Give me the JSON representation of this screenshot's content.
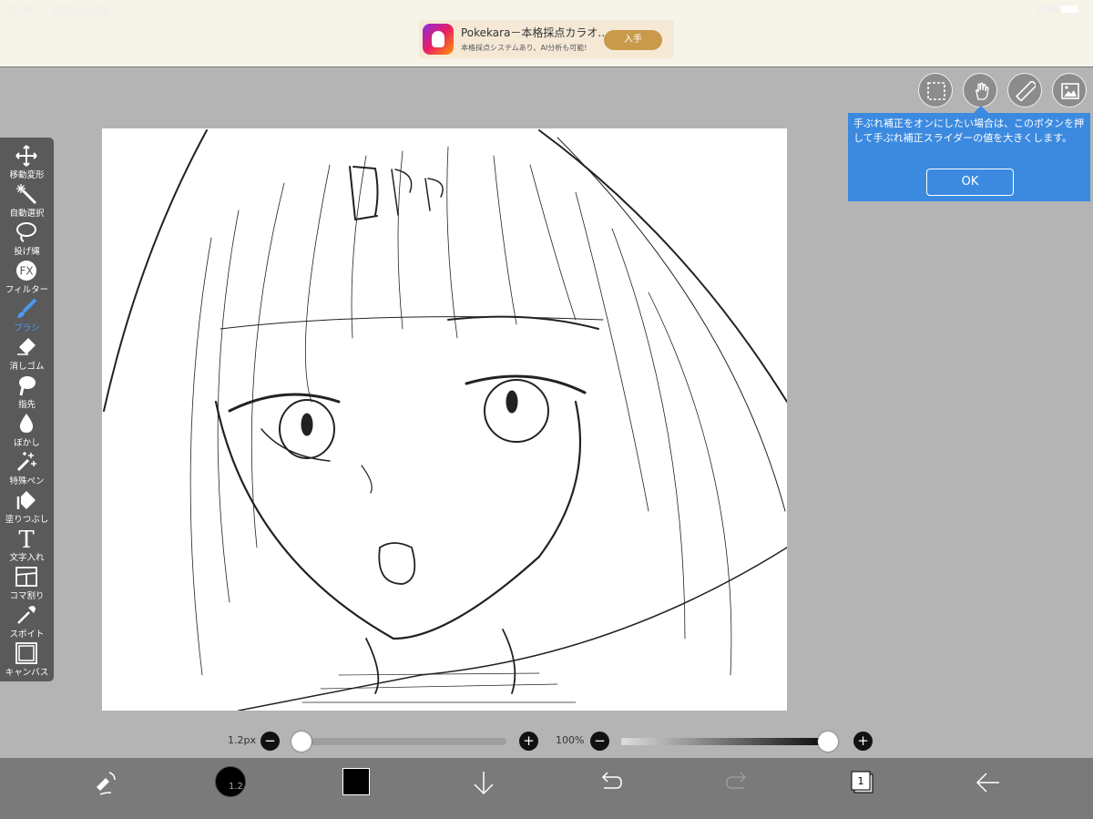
{
  "status": {
    "time": "22:49",
    "date": "2月27日(日)",
    "battery": "92%"
  },
  "ad": {
    "title": "Pokekara－本格採点カラオ...",
    "subtitle": "本格採点システムあり、AI分析も可能!",
    "button": "入手"
  },
  "tooltip": {
    "message": "手ぶれ補正をオンにしたい場合は、このボタンを押して手ぶれ補正スライダーの値を大きくします。",
    "ok": "OK"
  },
  "tools": [
    {
      "label": "移動変形",
      "icon": "move-icon"
    },
    {
      "label": "自動選択",
      "icon": "magic-wand-icon"
    },
    {
      "label": "投げ縄",
      "icon": "lasso-icon"
    },
    {
      "label": "フィルター",
      "icon": "fx-icon"
    },
    {
      "label": "ブラシ",
      "icon": "brush-icon",
      "active": true
    },
    {
      "label": "消しゴム",
      "icon": "eraser-icon"
    },
    {
      "label": "指先",
      "icon": "finger-icon"
    },
    {
      "label": "ぼかし",
      "icon": "blur-icon"
    },
    {
      "label": "特殊ペン",
      "icon": "special-pen-icon"
    },
    {
      "label": "塗りつぶし",
      "icon": "fill-icon"
    },
    {
      "label": "文字入れ",
      "icon": "text-icon"
    },
    {
      "label": "コマ割り",
      "icon": "frame-divider-icon"
    },
    {
      "label": "スポイト",
      "icon": "eyedropper-icon"
    },
    {
      "label": "キャンバス",
      "icon": "canvas-icon"
    }
  ],
  "brush": {
    "size_label": "1.2px",
    "size_fraction": 0.0,
    "opacity_label": "100%",
    "opacity_fraction": 1.0,
    "size_badge": "1.2"
  },
  "fx_text": "FX",
  "text_tool_glyph": "T",
  "layer_count": "1",
  "colors": {
    "accent": "#3b8ae0",
    "active_tool": "#4a9af0",
    "current_color": "#000000"
  }
}
